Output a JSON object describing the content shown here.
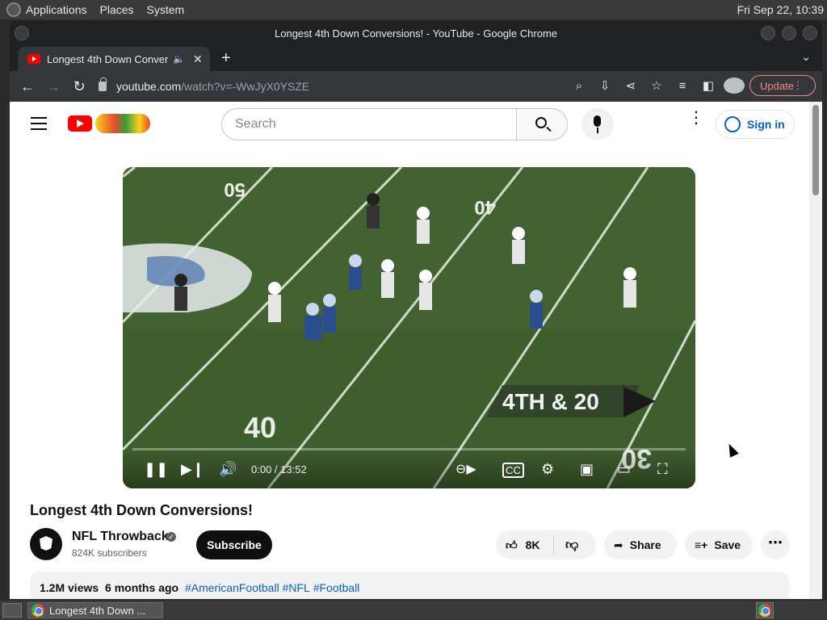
{
  "desktop": {
    "menus": [
      "Applications",
      "Places",
      "System"
    ],
    "clock": "Fri Sep 22, 10:39"
  },
  "window": {
    "title": "Longest 4th Down Conversions! - YouTube - Google Chrome"
  },
  "tab": {
    "title": "Longest 4th Down Conversions! - YouTube",
    "new_tab": "+",
    "close": "✕"
  },
  "toolbar": {
    "url_host": "youtube.com",
    "url_path": "/watch?v=-WwJyX0YSZE",
    "update_label": "Update"
  },
  "youtube": {
    "search_placeholder": "Search",
    "signin_label": "Sign in"
  },
  "video": {
    "time": "0:00 / 13:52",
    "progress": 0,
    "field_text": {
      "yard_50": "50",
      "yard_40_top": "40",
      "yard_40_bottom": "40",
      "yard_30": "30",
      "down_distance": "4TH & 20"
    },
    "title": "Longest 4th Down Conversions!"
  },
  "channel": {
    "name": "NFL Throwback",
    "subscribers": "824K subscribers",
    "subscribe_label": "Subscribe"
  },
  "actions": {
    "likes": "8K",
    "share_label": "Share",
    "save_label": "Save"
  },
  "description": {
    "views": "1.2M views",
    "age": "6 months ago",
    "tags": [
      "#AmericanFootball",
      "#NFL",
      "#Football"
    ]
  },
  "taskbar": {
    "item_label": "Longest 4th Down ..."
  },
  "colors": {
    "yt_red": "#ff0000",
    "link_blue": "#065fd4",
    "update_red": "#f28b82",
    "field_green": "#3d5b2c"
  }
}
